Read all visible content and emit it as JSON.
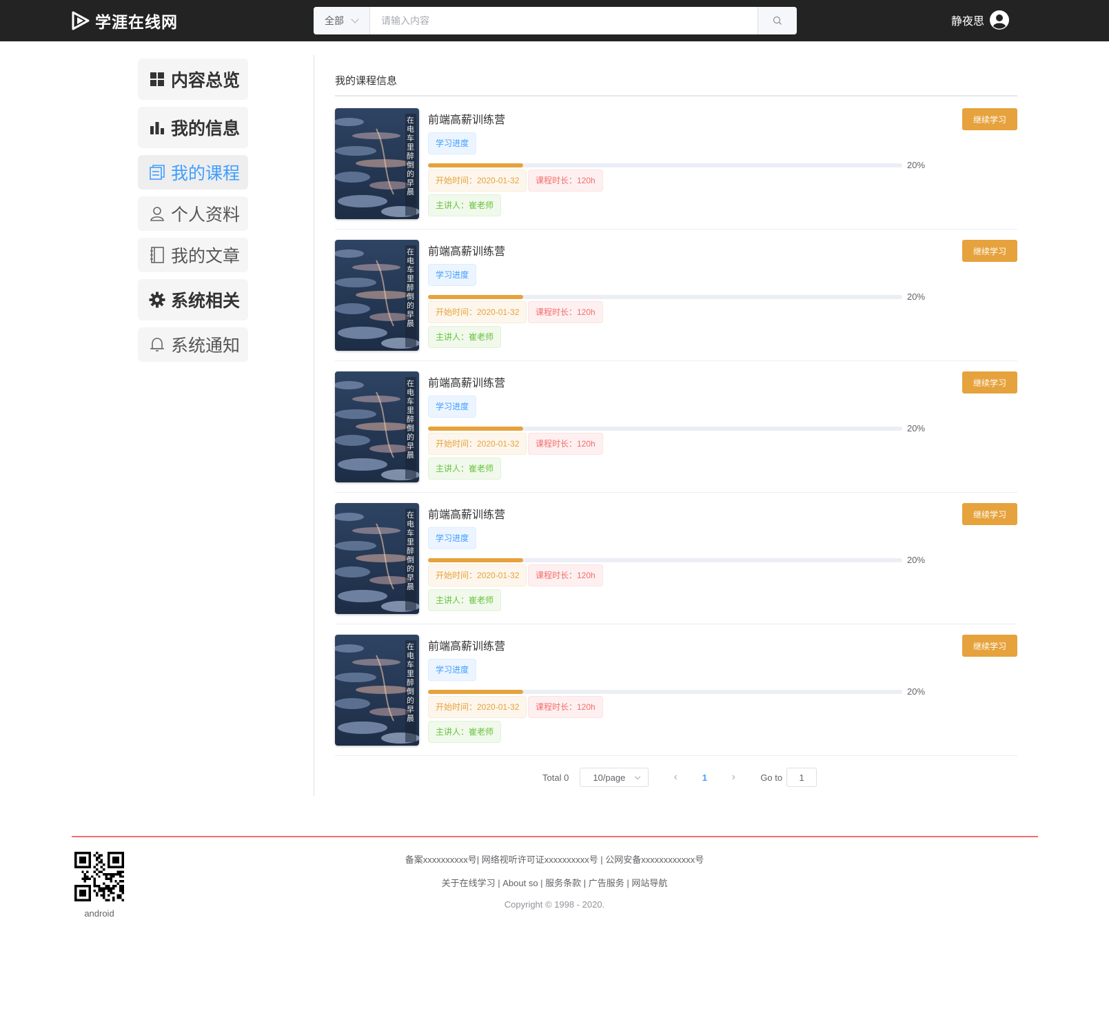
{
  "header": {
    "logo_text": "学涯在线网",
    "search": {
      "category": "全部",
      "placeholder": "请输入内容",
      "value": ""
    },
    "user_name": "静夜思"
  },
  "sidebar": {
    "items": [
      {
        "label": "内容总览",
        "icon": "grid-icon",
        "style": "bold"
      },
      {
        "label": "我的信息",
        "icon": "bar-chart-icon",
        "style": "bold"
      },
      {
        "label": "我的课程",
        "icon": "document-icon",
        "style": "active"
      },
      {
        "label": "个人资料",
        "icon": "user-icon",
        "style": "normal"
      },
      {
        "label": "我的文章",
        "icon": "notebook-icon",
        "style": "normal"
      },
      {
        "label": "系统相关",
        "icon": "gear-icon",
        "style": "bold"
      },
      {
        "label": "系统通知",
        "icon": "bell-icon",
        "style": "normal"
      }
    ]
  },
  "main": {
    "title": "我的课程信息",
    "courses": [
      {
        "name": "前端高薪训练营",
        "progress_tag": "学习进度",
        "progress": 20,
        "progress_text": "20%",
        "start": "开始时间：2020-01-32",
        "duration": "课程时长：120h",
        "teacher": "主讲人：崔老师",
        "button": "继续学习"
      },
      {
        "name": "前端高薪训练营",
        "progress_tag": "学习进度",
        "progress": 20,
        "progress_text": "20%",
        "start": "开始时间：2020-01-32",
        "duration": "课程时长：120h",
        "teacher": "主讲人：崔老师",
        "button": "继续学习"
      },
      {
        "name": "前端高薪训练营",
        "progress_tag": "学习进度",
        "progress": 20,
        "progress_text": "20%",
        "start": "开始时间：2020-01-32",
        "duration": "课程时长：120h",
        "teacher": "主讲人：崔老师",
        "button": "继续学习"
      },
      {
        "name": "前端高薪训练营",
        "progress_tag": "学习进度",
        "progress": 20,
        "progress_text": "20%",
        "start": "开始时间：2020-01-32",
        "duration": "课程时长：120h",
        "teacher": "主讲人：崔老师",
        "button": "继续学习"
      },
      {
        "name": "前端高薪训练营",
        "progress_tag": "学习进度",
        "progress": 20,
        "progress_text": "20%",
        "start": "开始时间：2020-01-32",
        "duration": "课程时长：120h",
        "teacher": "主讲人：崔老师",
        "button": "继续学习"
      }
    ],
    "cover_caption": "在电车里醉倒的早晨"
  },
  "pagination": {
    "total": "Total 0",
    "page_size": "10/page",
    "prev": "‹",
    "current": "1",
    "next": "›",
    "goto_label": "Go to",
    "goto_value": "1"
  },
  "footer": {
    "qr_label": "android",
    "line1": "备案xxxxxxxxxx号| 网络视听许可证xxxxxxxxxx号 | 公网安备xxxxxxxxxxxx号",
    "line2": "关于在线学习 | About so | 服务条款 | 广告服务 | 网站导航",
    "copyright": "Copyright © 1998 - 2020."
  },
  "colors": {
    "header_bg": "#232323",
    "accent_orange": "#e6a23c",
    "accent_blue": "#409eff",
    "footer_line": "#f56c6c"
  }
}
